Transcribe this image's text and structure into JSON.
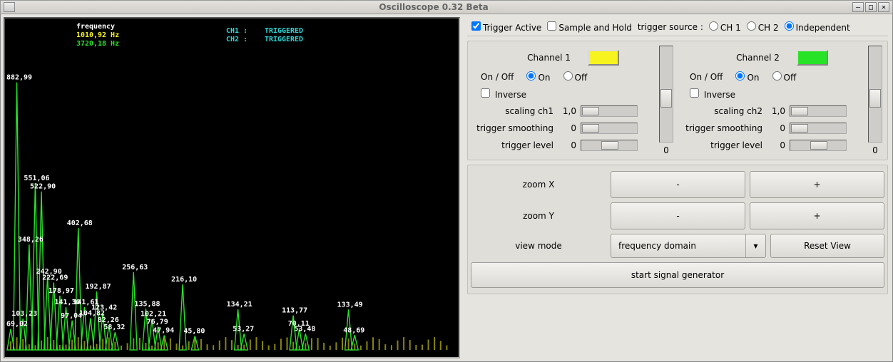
{
  "window": {
    "title": "Oscilloscope 0.32 Beta",
    "min_glyph": "–",
    "max_glyph": "□",
    "close_glyph": "×"
  },
  "scope": {
    "freq_label": "frequency",
    "freq_ch1": "1010,92 Hz",
    "freq_ch2": "3720,18 Hz",
    "ch1_status_label": "CH1 :",
    "ch1_status": "TRIGGERED",
    "ch2_status_label": "CH2 :",
    "ch2_status": "TRIGGERED",
    "colors": {
      "ch1": "#f7f31f",
      "ch2": "#27e327"
    }
  },
  "chart_data": {
    "type": "bar",
    "title": "frequency domain",
    "xlabel": "",
    "ylabel": "",
    "ylim": [
      0,
      1000
    ],
    "peaks": [
      {
        "idx": 1,
        "value": 882.99,
        "label": "882,99"
      },
      {
        "idx": 4,
        "value": 551.06,
        "label": "551,06"
      },
      {
        "idx": 5,
        "value": 522.9,
        "label": "522,90"
      },
      {
        "idx": 11,
        "value": 402.68,
        "label": "402,68"
      },
      {
        "idx": 3,
        "value": 348.26,
        "label": "348,26"
      },
      {
        "idx": 20,
        "value": 256.63,
        "label": "256,63"
      },
      {
        "idx": 6,
        "value": 242.9,
        "label": "242,90"
      },
      {
        "idx": 7,
        "value": 222.69,
        "label": "222,69"
      },
      {
        "idx": 28,
        "value": 216.1,
        "label": "216,10"
      },
      {
        "idx": 14,
        "value": 192.87,
        "label": "192,87"
      },
      {
        "idx": 8,
        "value": 178.97,
        "label": "178,97"
      },
      {
        "idx": 12,
        "value": 141.61,
        "label": "141,61"
      },
      {
        "idx": 9,
        "value": 141.3,
        "label": "141,30"
      },
      {
        "idx": 22,
        "value": 135.88,
        "label": "135,88"
      },
      {
        "idx": 37,
        "value": 134.21,
        "label": "134,21"
      },
      {
        "idx": 55,
        "value": 133.49,
        "label": "133,49"
      },
      {
        "idx": 15,
        "value": 123.42,
        "label": "123,42"
      },
      {
        "idx": 46,
        "value": 113.77,
        "label": "113,77"
      },
      {
        "idx": 13,
        "value": 104.82,
        "label": "104,82"
      },
      {
        "idx": 2,
        "value": 103.23,
        "label": "103,23"
      },
      {
        "idx": 23,
        "value": 102.21,
        "label": "102,21"
      },
      {
        "idx": 10,
        "value": 97.04,
        "label": "97,04"
      },
      {
        "idx": 16,
        "value": 82.26,
        "label": "82,26"
      },
      {
        "idx": 24,
        "value": 76.79,
        "label": "76,79"
      },
      {
        "idx": 47,
        "value": 70.11,
        "label": "70,11"
      },
      {
        "idx": 0,
        "value": 69.02,
        "label": "69,02"
      },
      {
        "idx": 17,
        "value": 58.32,
        "label": "58,32"
      },
      {
        "idx": 38,
        "value": 53.27,
        "label": "53,27"
      },
      {
        "idx": 48,
        "value": 53.48,
        "label": "53,48"
      },
      {
        "idx": 56,
        "value": 48.69,
        "label": "48,69"
      },
      {
        "idx": 25,
        "value": 47.94,
        "label": "47,94"
      },
      {
        "idx": 30,
        "value": 45.8,
        "label": "45,80"
      }
    ]
  },
  "trigger": {
    "active_label": "Trigger Active",
    "sample_hold_label": "Sample and Hold",
    "source_label": "trigger source :",
    "ch1_label": "CH 1",
    "ch2_label": "CH 2",
    "independent_label": "Independent"
  },
  "channels": [
    {
      "title": "Channel 1",
      "color": "#f7f31f",
      "onoff_label": "On / Off",
      "on_label": "On",
      "off_label": "Off",
      "inverse_label": "Inverse",
      "scaling_label": "scaling ch1",
      "scaling_value": "1,0",
      "smoothing_label": "trigger smoothing",
      "smoothing_value": "0",
      "level_label": "trigger level",
      "level_value": "0",
      "vslider_readout": "0"
    },
    {
      "title": "Channel 2",
      "color": "#27e327",
      "onoff_label": "On / Off",
      "on_label": "On",
      "off_label": "Off",
      "inverse_label": "Inverse",
      "scaling_label": "scaling ch2",
      "scaling_value": "1,0",
      "smoothing_label": "trigger smoothing",
      "smoothing_value": "0",
      "level_label": "trigger level",
      "level_value": "0",
      "vslider_readout": "0"
    }
  ],
  "zoom": {
    "x_label": "zoom X",
    "y_label": "zoom Y",
    "minus": "-",
    "plus": "+"
  },
  "view": {
    "mode_label": "view mode",
    "mode_value": "frequency domain",
    "reset_label": "Reset View"
  },
  "siggen": {
    "label": "start signal generator"
  }
}
